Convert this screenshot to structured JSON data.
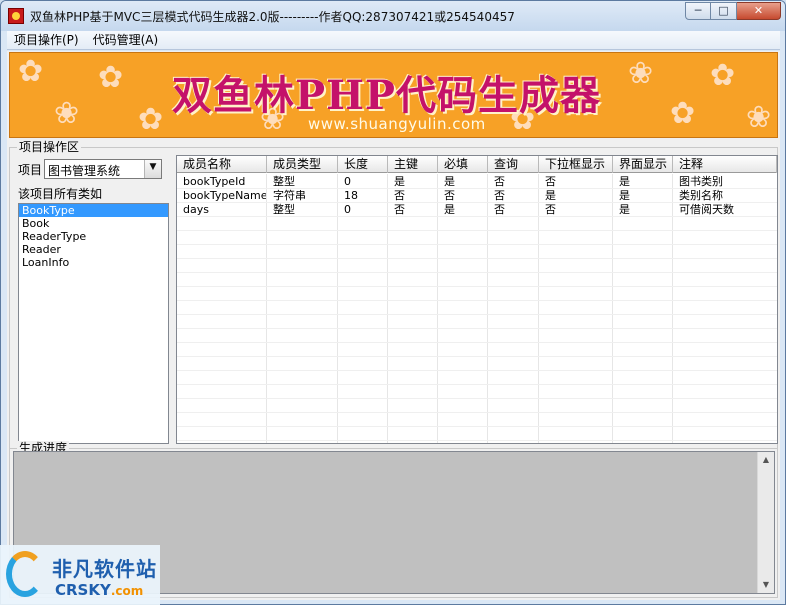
{
  "window": {
    "title": "双鱼林PHP基于MVC三层模式代码生成器2.0版---------作者QQ:287307421或254540457",
    "minimize_glyph": "─",
    "maximize_glyph": "□",
    "close_glyph": "✕"
  },
  "menu": [
    {
      "label": "项目操作(P)"
    },
    {
      "label": "代码管理(A)"
    }
  ],
  "banner": {
    "title": "双鱼林PHP代码生成器",
    "url": "www.shuangyulin.com"
  },
  "project_area": {
    "legend": "项目操作区",
    "project_label": "项目",
    "project_value": "图书管理系统",
    "classes_caption": "该项目所有类如",
    "classes": [
      {
        "label": "BookType",
        "selected": true
      },
      {
        "label": "Book",
        "selected": false
      },
      {
        "label": "ReaderType",
        "selected": false
      },
      {
        "label": "Reader",
        "selected": false
      },
      {
        "label": "LoanInfo",
        "selected": false
      }
    ]
  },
  "grid": {
    "columns": [
      "成员名称",
      "成员类型",
      "长度",
      "主键",
      "必填",
      "查询",
      "下拉框显示",
      "界面显示",
      "注释"
    ],
    "rows": [
      [
        "bookTypeId",
        "整型",
        "0",
        "是",
        "是",
        "否",
        "否",
        "是",
        "图书类别"
      ],
      [
        "bookTypeName",
        "字符串",
        "18",
        "否",
        "否",
        "否",
        "是",
        "是",
        "类别名称"
      ],
      [
        "days",
        "整型",
        "0",
        "否",
        "是",
        "否",
        "否",
        "是",
        "可借阅天数"
      ]
    ]
  },
  "progress": {
    "legend": "生成进度",
    "up_glyph": "▲",
    "down_glyph": "▼"
  },
  "watermark": {
    "cn": "非凡软件站",
    "en": "CRSKY",
    "domain": ".com"
  },
  "colors": {
    "banner_bg": "#f7a126",
    "banner_title": "#c4126a",
    "selection": "#3399ff"
  }
}
